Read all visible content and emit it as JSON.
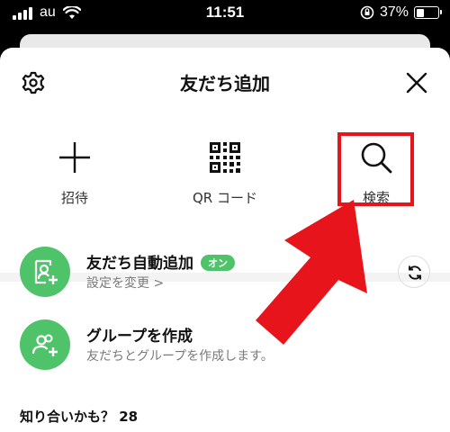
{
  "status_bar": {
    "carrier": "au",
    "time": "11:51",
    "battery_percent": "37%",
    "battery_level": 0.37
  },
  "sheet": {
    "title": "友だち追加",
    "icons": {
      "settings": "gear-icon",
      "close": "close-icon"
    }
  },
  "actions": [
    {
      "label": "招待",
      "icon": "plus-icon"
    },
    {
      "label": "QR コード",
      "icon": "qr-code-icon"
    },
    {
      "label": "検索",
      "icon": "search-icon"
    }
  ],
  "auto_add": {
    "title": "友だち自動追加",
    "badge": "オン",
    "subtitle": "設定を変更",
    "chevron": ">"
  },
  "create_group": {
    "title": "グループを作成",
    "subtitle": "友だちとグループを作成します。"
  },
  "suggestions": {
    "label": "知り合いかも？",
    "count": "28"
  },
  "colors": {
    "accent_green": "#4fc36a",
    "highlight_red": "#e8141c"
  }
}
